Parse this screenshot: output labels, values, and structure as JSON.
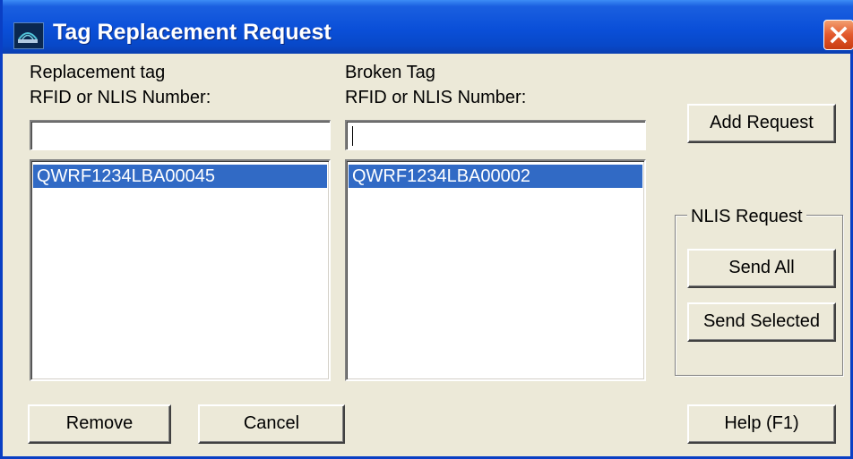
{
  "window": {
    "title": "Tag Replacement Request"
  },
  "replacement": {
    "label_line1": "Replacement tag",
    "label_line2": "RFID or NLIS Number:",
    "input_value": "",
    "list_items": [
      "QWRF1234LBA00045"
    ]
  },
  "broken": {
    "label_line1": "Broken Tag",
    "label_line2": "RFID or NLIS Number:",
    "input_value": "",
    "list_items": [
      "QWRF1234LBA00002"
    ]
  },
  "buttons": {
    "add_request": "Add Request",
    "remove": "Remove",
    "cancel": "Cancel",
    "help": "Help (F1)"
  },
  "nlis_request": {
    "legend": "NLIS Request",
    "send_all": "Send All",
    "send_selected": "Send Selected"
  },
  "colors": {
    "title_bar": "#0a4fd8",
    "selection": "#316ac5",
    "close_button": "#e2582c",
    "dialog_bg": "#ece9d8"
  },
  "icons": {
    "title": "app-icon",
    "close": "close-icon"
  }
}
